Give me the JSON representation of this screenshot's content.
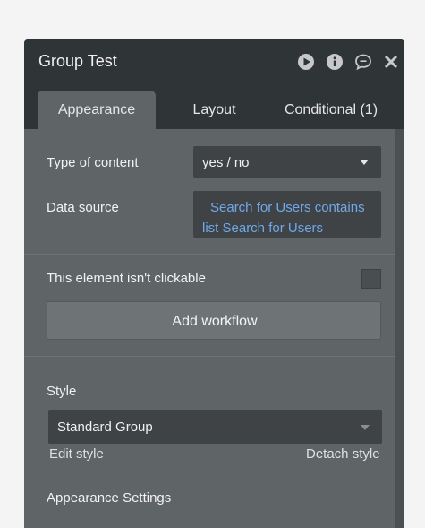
{
  "panel": {
    "title": "Group Test",
    "icons": [
      "play-icon",
      "info-icon",
      "comment-icon",
      "close-icon"
    ]
  },
  "tabs": [
    {
      "label": "Appearance",
      "active": true
    },
    {
      "label": "Layout",
      "active": false
    },
    {
      "label": "Conditional (1)",
      "active": false
    }
  ],
  "fields": {
    "type_of_content_label": "Type of content",
    "type_of_content_value": "yes / no",
    "data_source_label": "Data source",
    "data_source_line1": "Search for Users contains",
    "data_source_line2": "list Search for Users"
  },
  "clickable": {
    "label": "This element isn't clickable",
    "checked": false
  },
  "workflow_button": "Add workflow",
  "style": {
    "label": "Style",
    "value": "Standard Group",
    "edit_link": "Edit style",
    "detach_link": "Detach style"
  },
  "appearance_settings": "Appearance Settings",
  "colors": {
    "panel_bg": "#5f6466",
    "header_bg": "#2f3436",
    "input_bg": "#3f4345",
    "link_blue": "#6fa9ea"
  }
}
